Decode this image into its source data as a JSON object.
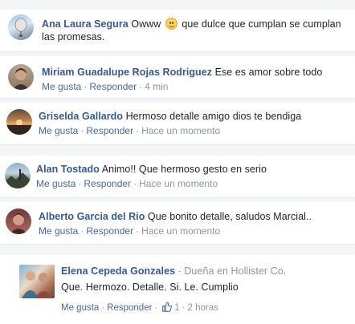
{
  "comments": [
    {
      "author": "Ana Laura Segura",
      "text_before_emoji": "Owww",
      "emoji": "smile-emoji",
      "text_after_emoji": "que dulce que cumplan se cumplan las promesas.",
      "avatar": "avatar-balloon"
    },
    {
      "author": "Miriam Guadalupe Rojas Rodriguez",
      "text": "Ese es amor sobre todo",
      "like_label": "Me gusta",
      "reply_label": "Responder",
      "time": "4 min"
    },
    {
      "author": "Griselda Gallardo",
      "text": "Hermoso detalle amigo dios te bendiga",
      "like_label": "Me gusta",
      "reply_label": "Responder",
      "time": "Hace un momento"
    },
    {
      "author": "Alan Tostado",
      "text": "Animo!! Que hermoso gesto en serio",
      "like_label": "Me gusta",
      "reply_label": "Responder",
      "time": "Hace un momento"
    },
    {
      "author": "Alberto Garcia del Rio",
      "text": "Que bonito detalle, saludos Marcial..",
      "like_label": "Me gusta",
      "reply_label": "Responder",
      "time": "Hace un momento"
    }
  ],
  "reply": {
    "author": "Elena Cepeda Gonzales",
    "role": "Dueña en Hollister Co.",
    "text": "Que. Hermozo. Detalle. Si. Le. Cumplio",
    "like_label": "Me gusta",
    "reply_label": "Responder",
    "like_count": "1",
    "time": "2 horas",
    "colors": {
      "link": "#4b67a1",
      "name": "#365899",
      "meta": "#90949c"
    }
  }
}
